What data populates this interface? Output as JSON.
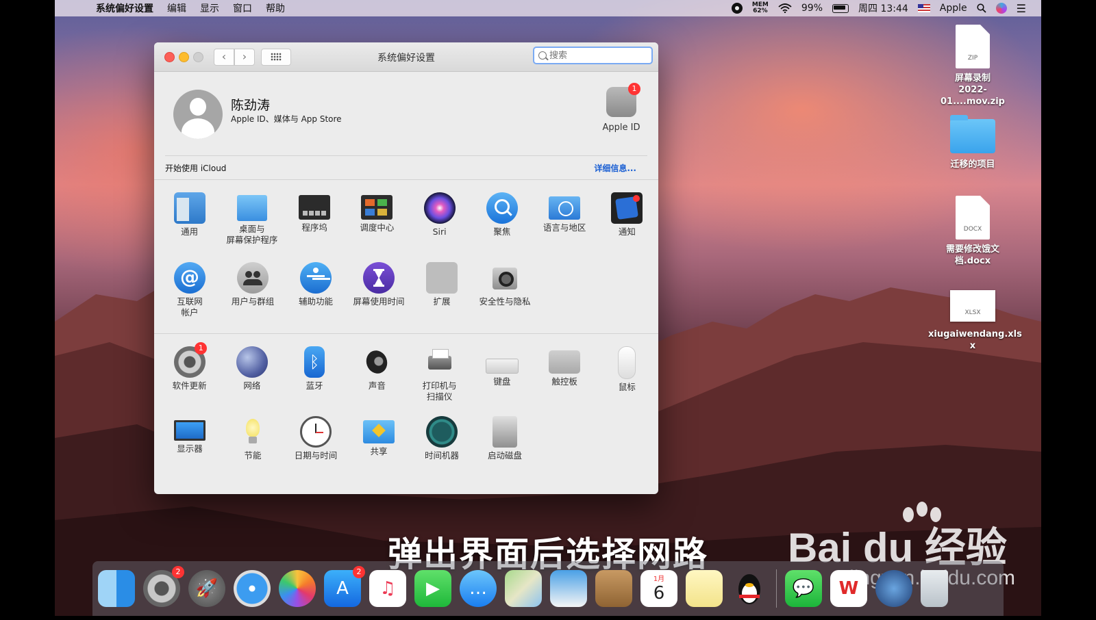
{
  "menubar": {
    "app_name": "系统偏好设置",
    "items": [
      "编辑",
      "显示",
      "窗口",
      "帮助"
    ],
    "mem_label": "MEM",
    "mem_value": "62%",
    "battery": "99%",
    "clock": "周四 13:44",
    "user": "Apple"
  },
  "window": {
    "title": "系统偏好设置",
    "search_placeholder": "搜索",
    "account": {
      "name": "陈劲涛",
      "subtitle": "Apple ID、媒体与 App Store",
      "apple_id_label": "Apple ID",
      "apple_id_badge": "1"
    },
    "icloud": {
      "text": "开始使用 iCloud",
      "more": "详细信息..."
    },
    "prefs_row1": [
      "通用",
      "桌面与\n屏幕保护程序",
      "程序坞",
      "调度中心",
      "Siri",
      "聚焦",
      "语言与地区",
      "通知"
    ],
    "prefs_row2": [
      "互联网\n帐户",
      "用户与群组",
      "辅助功能",
      "屏幕使用时间",
      "扩展",
      "安全性与隐私"
    ],
    "prefs_row3": [
      "软件更新",
      "网络",
      "蓝牙",
      "声音",
      "打印机与\n扫描仪",
      "键盘",
      "触控板",
      "鼠标"
    ],
    "prefs_row4": [
      "显示器",
      "节能",
      "日期与时间",
      "共享",
      "时间机器",
      "启动磁盘"
    ],
    "update_badge": "1",
    "general_icon_text": [
      "File",
      "New",
      "One"
    ]
  },
  "desktop": {
    "zip": {
      "type": "ZIP",
      "name": "屏幕录制\n2022-01....mov.zip"
    },
    "folder": {
      "name": "迁移的项目"
    },
    "docx": {
      "type": "DOCX",
      "name": "需要修改饿文\n档.docx"
    },
    "xlsx": {
      "type": "XLSX",
      "name": "xiugaiwendang.xls\nx"
    }
  },
  "caption": "弹出界面后选择网路",
  "watermark": {
    "brand": "Bai du 经验",
    "url": "jingyan.baidu.com"
  },
  "dock": {
    "system_prefs_badge": "2",
    "appstore_badge": "2",
    "calendar_month": "1月",
    "calendar_day": "6"
  }
}
